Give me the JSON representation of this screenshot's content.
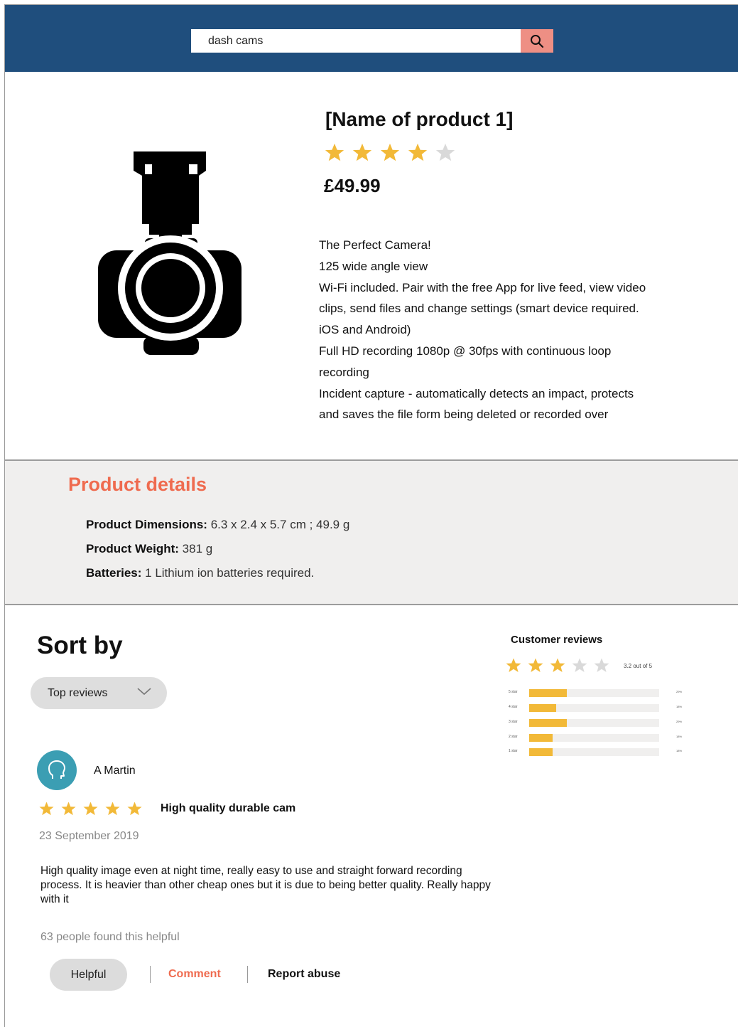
{
  "search": {
    "value": "dash cams"
  },
  "product": {
    "name": "[Name of product 1]",
    "rating_stars": 4,
    "max_stars": 5,
    "price": "£49.99",
    "description_lines": [
      "The Perfect Camera!",
      "125 wide angle view",
      "Wi-Fi included. Pair with the free App for live feed, view video",
      "clips, send files and change settings (smart device required.",
      "iOS and Android)",
      "Full HD recording 1080p @ 30fps with continuous loop",
      "recording",
      "Incident capture - automatically detects an impact, protects",
      "and saves the file form being deleted or recorded over"
    ]
  },
  "details": {
    "title": "Product details",
    "rows": [
      {
        "label": "Product Dimensions:",
        "value": " 6.3 x 2.4 x 5.7 cm ; 49.9 g"
      },
      {
        "label": "Product Weight:",
        "value": " 381 g"
      },
      {
        "label": "Batteries:",
        "value": " 1 Lithium ion batteries required."
      }
    ]
  },
  "reviews": {
    "sort_title": "Sort by",
    "sort_selected": "Top reviews",
    "review": {
      "author": "A Martin",
      "stars": 5,
      "title": "High quality durable cam",
      "date": "23 September 2019",
      "body": "High quality image even at night time, really easy to use and straight forward recording process. It is heavier than other cheap ones but it is due to being better quality. Really happy with it",
      "helpful_count_text": "63 people found this helpful",
      "helpful_label": "Helpful",
      "comment_label": "Comment",
      "report_label": "Report abuse"
    }
  },
  "customer_reviews": {
    "title": "Customer reviews",
    "stars": 3,
    "out_of_text": "3.2 out of 5",
    "histogram": [
      {
        "label": "5 star",
        "fraction": 0.29,
        "pct": "29%"
      },
      {
        "label": "4 star",
        "fraction": 0.21,
        "pct": "18%"
      },
      {
        "label": "3 star",
        "fraction": 0.29,
        "pct": "29%"
      },
      {
        "label": "2 star",
        "fraction": 0.18,
        "pct": "18%"
      },
      {
        "label": "1 star",
        "fraction": 0.18,
        "pct": "18%"
      }
    ]
  },
  "colors": {
    "header": "#1f4e7d",
    "accent": "#ef6b4f",
    "star_filled": "#f2b938",
    "star_empty": "#d9d9d9",
    "avatar": "#3b9eb3"
  },
  "icons": [
    "search-icon",
    "dash-cam-image",
    "chevron-down-icon",
    "user-head-icon",
    "star-icon"
  ]
}
